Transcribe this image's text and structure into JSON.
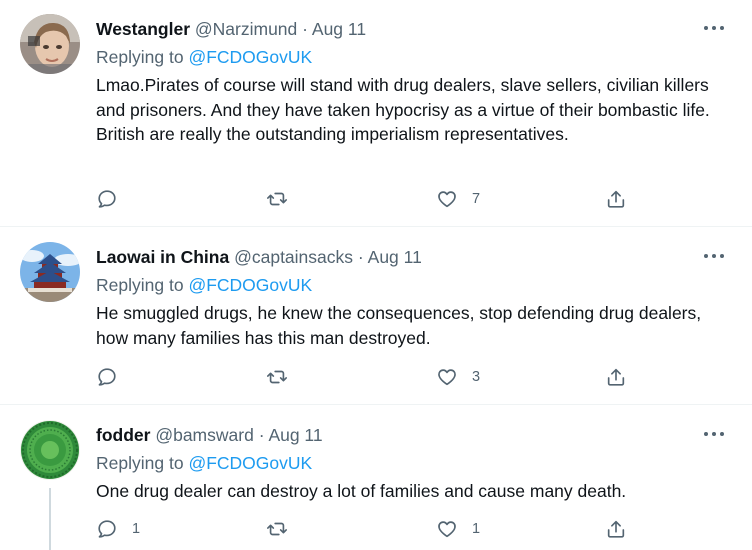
{
  "tweets": [
    {
      "name": "Westangler",
      "handle": "@Narzimund",
      "separator": "·",
      "date": "Aug 11",
      "replying_label": "Replying to",
      "replying_handle": "@FCDOGovUK",
      "text": "Lmao.Pirates of course will stand with drug dealers, slave sellers, civilian killers and prisoners. And they have taken hypocrisy as a virtue of their bombastic life. British are really the outstanding imperialism representatives.",
      "reply_count": "",
      "retweet_count": "",
      "like_count": "7"
    },
    {
      "name": "Laowai in China",
      "handle": "@captainsacks",
      "separator": "·",
      "date": "Aug 11",
      "replying_label": "Replying to",
      "replying_handle": "@FCDOGovUK",
      "text": "He smuggled drugs, he knew the consequences, stop defending drug dealers, how many families has this man destroyed.",
      "reply_count": "",
      "retweet_count": "",
      "like_count": "3"
    },
    {
      "name": "fodder",
      "handle": "@bamsward",
      "separator": "·",
      "date": "Aug 11",
      "replying_label": "Replying to",
      "replying_handle": "@FCDOGovUK",
      "text": "One drug dealer can destroy a lot of families and cause many death.",
      "reply_count": "1",
      "retweet_count": "",
      "like_count": "1"
    }
  ],
  "colors": {
    "text": "#0f1419",
    "secondary": "#536471",
    "link": "#1d9bf0",
    "divider": "#eff3f4"
  },
  "icons": [
    "more-icon",
    "reply-icon",
    "retweet-icon",
    "like-icon",
    "share-icon"
  ]
}
